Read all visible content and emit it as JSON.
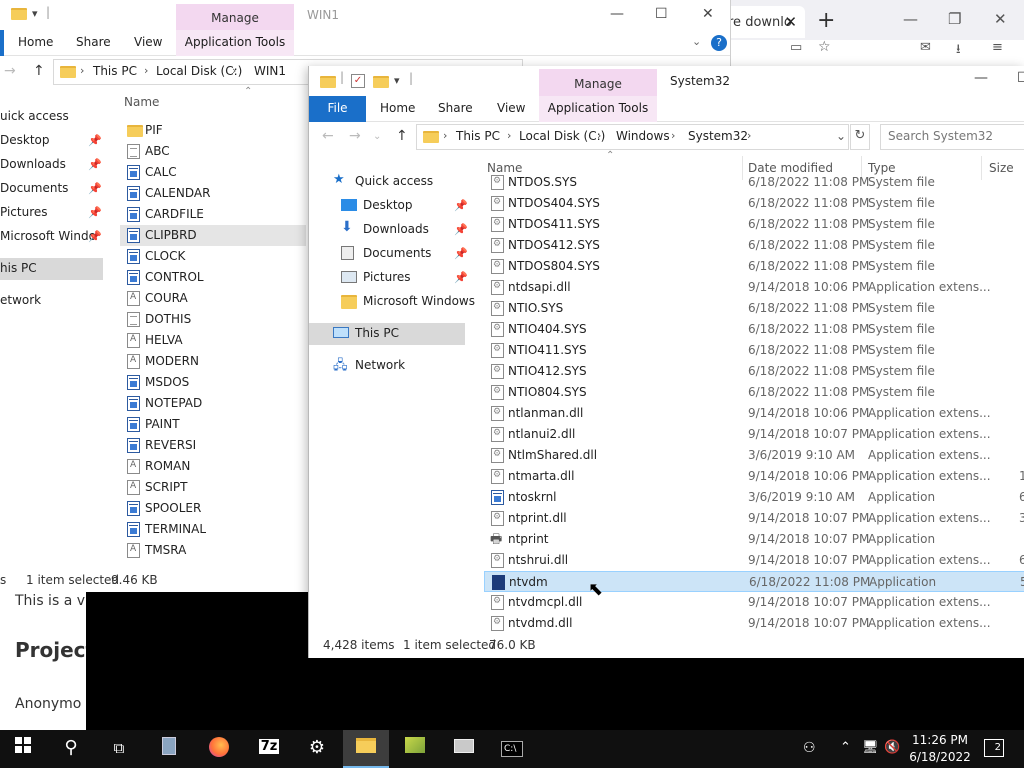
{
  "browser": {
    "tab_label": "re downlo",
    "new_tab": "+",
    "minimize": "—",
    "maximize": "❐",
    "close": "✕"
  },
  "web": {
    "para1": "This is a vi",
    "heading": "Project",
    "para2": "Anonymo"
  },
  "win1": {
    "title": "WIN1",
    "manage_tab": "Manage",
    "ribbon_tabs": [
      "Home",
      "Share",
      "View"
    ],
    "app_tools": "Application Tools",
    "breadcrumb": [
      "This PC",
      "Local Disk (C:)",
      "WIN1"
    ],
    "nav": [
      {
        "label": "uick access",
        "pinned": false
      },
      {
        "label": "Desktop",
        "pinned": true
      },
      {
        "label": "Downloads",
        "pinned": true
      },
      {
        "label": "Documents",
        "pinned": true
      },
      {
        "label": "Pictures",
        "pinned": true
      },
      {
        "label": "Microsoft Windo",
        "pinned": true
      },
      {
        "label": "his PC",
        "pinned": false
      },
      {
        "label": "etwork",
        "pinned": false
      }
    ],
    "col_name": "Name",
    "files": [
      {
        "name": "PIF",
        "icon": "folder"
      },
      {
        "name": "ABC",
        "icon": "txt"
      },
      {
        "name": "CALC",
        "icon": "app"
      },
      {
        "name": "CALENDAR",
        "icon": "app"
      },
      {
        "name": "CARDFILE",
        "icon": "app"
      },
      {
        "name": "CLIPBRD",
        "icon": "app"
      },
      {
        "name": "CLOCK",
        "icon": "app"
      },
      {
        "name": "CONTROL",
        "icon": "app"
      },
      {
        "name": "COURA",
        "icon": "font"
      },
      {
        "name": "DOTHIS",
        "icon": "txt"
      },
      {
        "name": "HELVA",
        "icon": "font"
      },
      {
        "name": "MODERN",
        "icon": "font"
      },
      {
        "name": "MSDOS",
        "icon": "app"
      },
      {
        "name": "NOTEPAD",
        "icon": "app"
      },
      {
        "name": "PAINT",
        "icon": "app"
      },
      {
        "name": "REVERSI",
        "icon": "app"
      },
      {
        "name": "ROMAN",
        "icon": "font"
      },
      {
        "name": "SCRIPT",
        "icon": "font"
      },
      {
        "name": "SPOOLER",
        "icon": "app"
      },
      {
        "name": "TERMINAL",
        "icon": "app"
      },
      {
        "name": "TMSRA",
        "icon": "font"
      }
    ],
    "status_items": "s",
    "status_sel": "1 item selected",
    "status_size": "9.46 KB"
  },
  "win2": {
    "title": "System32",
    "manage_tab": "Manage",
    "file_tab": "File",
    "ribbon_tabs": [
      "Home",
      "Share",
      "View"
    ],
    "app_tools": "Application Tools",
    "breadcrumb": [
      "This PC",
      "Local Disk (C:)",
      "Windows",
      "System32"
    ],
    "search_placeholder": "Search System32",
    "nav": [
      {
        "label": "Quick access",
        "pinned": false
      },
      {
        "label": "Desktop",
        "pinned": true
      },
      {
        "label": "Downloads",
        "pinned": true
      },
      {
        "label": "Documents",
        "pinned": true
      },
      {
        "label": "Pictures",
        "pinned": true
      },
      {
        "label": "Microsoft Windows",
        "pinned": false
      },
      {
        "label": "This PC",
        "pinned": false
      },
      {
        "label": "Network",
        "pinned": false
      }
    ],
    "columns": {
      "name": "Name",
      "date": "Date modified",
      "type": "Type",
      "size": "Size"
    },
    "files": [
      {
        "name": "NTDOS.SYS",
        "date": "6/18/2022 11:08 PM",
        "type": "System file",
        "size": "",
        "icon": "gear"
      },
      {
        "name": "NTDOS404.SYS",
        "date": "6/18/2022 11:08 PM",
        "type": "System file",
        "size": "",
        "icon": "gear"
      },
      {
        "name": "NTDOS411.SYS",
        "date": "6/18/2022 11:08 PM",
        "type": "System file",
        "size": "",
        "icon": "gear"
      },
      {
        "name": "NTDOS412.SYS",
        "date": "6/18/2022 11:08 PM",
        "type": "System file",
        "size": "",
        "icon": "gear"
      },
      {
        "name": "NTDOS804.SYS",
        "date": "6/18/2022 11:08 PM",
        "type": "System file",
        "size": "",
        "icon": "gear"
      },
      {
        "name": "ntdsapi.dll",
        "date": "9/14/2018 10:06 PM",
        "type": "Application extens...",
        "size": "",
        "icon": "gear"
      },
      {
        "name": "NTIO.SYS",
        "date": "6/18/2022 11:08 PM",
        "type": "System file",
        "size": "",
        "icon": "gear"
      },
      {
        "name": "NTIO404.SYS",
        "date": "6/18/2022 11:08 PM",
        "type": "System file",
        "size": "",
        "icon": "gear"
      },
      {
        "name": "NTIO411.SYS",
        "date": "6/18/2022 11:08 PM",
        "type": "System file",
        "size": "",
        "icon": "gear"
      },
      {
        "name": "NTIO412.SYS",
        "date": "6/18/2022 11:08 PM",
        "type": "System file",
        "size": "",
        "icon": "gear"
      },
      {
        "name": "NTIO804.SYS",
        "date": "6/18/2022 11:08 PM",
        "type": "System file",
        "size": "",
        "icon": "gear"
      },
      {
        "name": "ntlanman.dll",
        "date": "9/14/2018 10:06 PM",
        "type": "Application extens...",
        "size": "",
        "icon": "gear"
      },
      {
        "name": "ntlanui2.dll",
        "date": "9/14/2018 10:07 PM",
        "type": "Application extens...",
        "size": "",
        "icon": "gear"
      },
      {
        "name": "NtlmShared.dll",
        "date": "3/6/2019 9:10 AM",
        "type": "Application extens...",
        "size": "",
        "icon": "gear"
      },
      {
        "name": "ntmarta.dll",
        "date": "9/14/2018 10:06 PM",
        "type": "Application extens...",
        "size": "1",
        "icon": "gear"
      },
      {
        "name": "ntoskrnl",
        "date": "3/6/2019 9:10 AM",
        "type": "Application",
        "size": "6,7",
        "icon": "app"
      },
      {
        "name": "ntprint.dll",
        "date": "9/14/2018 10:07 PM",
        "type": "Application extens...",
        "size": "3",
        "icon": "gear"
      },
      {
        "name": "ntprint",
        "date": "9/14/2018 10:07 PM",
        "type": "Application",
        "size": "",
        "icon": "printer"
      },
      {
        "name": "ntshrui.dll",
        "date": "9/14/2018 10:07 PM",
        "type": "Application extens...",
        "size": "6",
        "icon": "gear"
      },
      {
        "name": "ntvdm",
        "date": "6/18/2022 11:08 PM",
        "type": "Application",
        "size": "5",
        "icon": "dos"
      },
      {
        "name": "ntvdmcpl.dll",
        "date": "9/14/2018 10:07 PM",
        "type": "Application extens...",
        "size": "",
        "icon": "gear"
      },
      {
        "name": "ntvdmd.dll",
        "date": "9/14/2018 10:07 PM",
        "type": "Application extens...",
        "size": "",
        "icon": "gear"
      }
    ],
    "status_items": "4,428 items",
    "status_sel": "1 item selected",
    "status_size": "76.0 KB"
  },
  "taskbar": {
    "time": "11:26 PM",
    "date": "6/18/2022",
    "notif_count": "2"
  },
  "colors": {
    "selection": "#cce4f7",
    "manage_tab": "#f3d8f0",
    "file_tab": "#1a6fc9",
    "taskbar": "#101010"
  }
}
